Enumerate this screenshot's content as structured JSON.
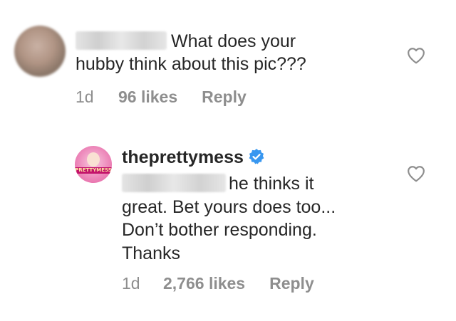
{
  "comments": [
    {
      "avatar_icon": "blurred-profile-photo",
      "text": "What does your",
      "text_line2": "hubby think about this pic???",
      "time": "1d",
      "likes": "96 likes",
      "reply_label": "Reply",
      "like_icon": "heart-outline-icon"
    },
    {
      "avatar_icon": "pretty-mess-logo",
      "avatar_text": "PRETTYMESS",
      "username": "theprettymess",
      "verified_icon": "verified-badge-icon",
      "verified_color": "#3897f0",
      "text_line1": "he thinks it",
      "text_line2": "great. Bet yours does too...",
      "text_line3": "Don’t bother responding.",
      "text_line4": "Thanks",
      "time": "1d",
      "likes": "2,766 likes",
      "reply_label": "Reply",
      "like_icon": "heart-outline-icon"
    }
  ]
}
